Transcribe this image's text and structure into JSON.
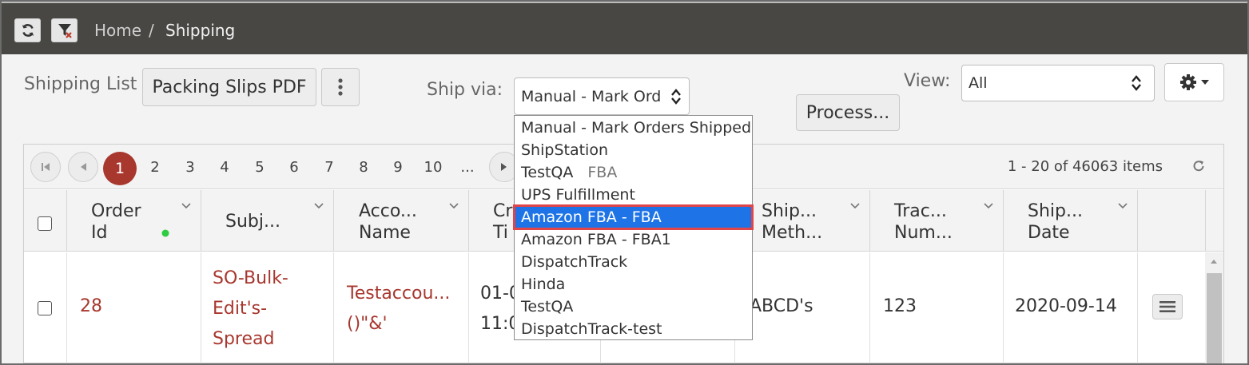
{
  "breadcrumb": {
    "home": "Home",
    "sep": "/",
    "current": "Shipping"
  },
  "toolbar": {
    "shipping_list_label": "Shipping List",
    "packing_slips_label": "Packing Slips PDF",
    "ship_via_label": "Ship via:",
    "ship_via_value": "Manual - Mark Ord",
    "process_label": "Process...",
    "view_label": "View:",
    "view_value": "All"
  },
  "ship_via_options": [
    {
      "label": "Manual - Mark Orders Shipped",
      "tag": ""
    },
    {
      "label": "ShipStation",
      "tag": ""
    },
    {
      "label": "TestQA",
      "tag": "FBA"
    },
    {
      "label": "UPS Fulfillment",
      "tag": ""
    },
    {
      "label": "Amazon FBA - FBA",
      "tag": "",
      "selected": true
    },
    {
      "label": "Amazon FBA - FBA1",
      "tag": ""
    },
    {
      "label": "DispatchTrack",
      "tag": ""
    },
    {
      "label": "Hinda",
      "tag": ""
    },
    {
      "label": "TestQA",
      "tag": ""
    },
    {
      "label": "DispatchTrack-test",
      "tag": ""
    }
  ],
  "pager": {
    "active_page": "1",
    "pages": [
      "2",
      "3",
      "4",
      "5",
      "6",
      "7",
      "8",
      "9",
      "10",
      "..."
    ],
    "items_info": "1 - 20 of 46063 items"
  },
  "columns": {
    "order_id": [
      "Order",
      "Id"
    ],
    "subject": [
      "Subj..."
    ],
    "account": [
      "Acco...",
      "Name"
    ],
    "created": [
      "Cr",
      "Ti"
    ],
    "ship_method": [
      "Ship...",
      "Meth..."
    ],
    "tracking": [
      "Trac...",
      "Num..."
    ],
    "ship_date": [
      "Ship...",
      "Date"
    ]
  },
  "rows": [
    {
      "order_id": "28",
      "subject": [
        "SO-Bulk-",
        "Edit's-",
        "Spread"
      ],
      "account": [
        "Testaccou...",
        "()\"&'"
      ],
      "created": [
        "01-0",
        "11:0"
      ],
      "ship_method": "ABCD's",
      "tracking": "123",
      "ship_date": "2020-09-14"
    }
  ],
  "colors": {
    "accent": "#a8372e",
    "header": "#494744",
    "selected": "#1e74e6",
    "highlight": "#e0454a"
  },
  "icons": [
    "refresh-icon",
    "filter-clear-icon",
    "kebab-menu-icon",
    "gear-icon",
    "caret-down-icon",
    "first-page-icon",
    "prev-page-icon",
    "next-page-icon",
    "reload-icon",
    "hamburger-menu-icon",
    "status-dot-icon"
  ]
}
